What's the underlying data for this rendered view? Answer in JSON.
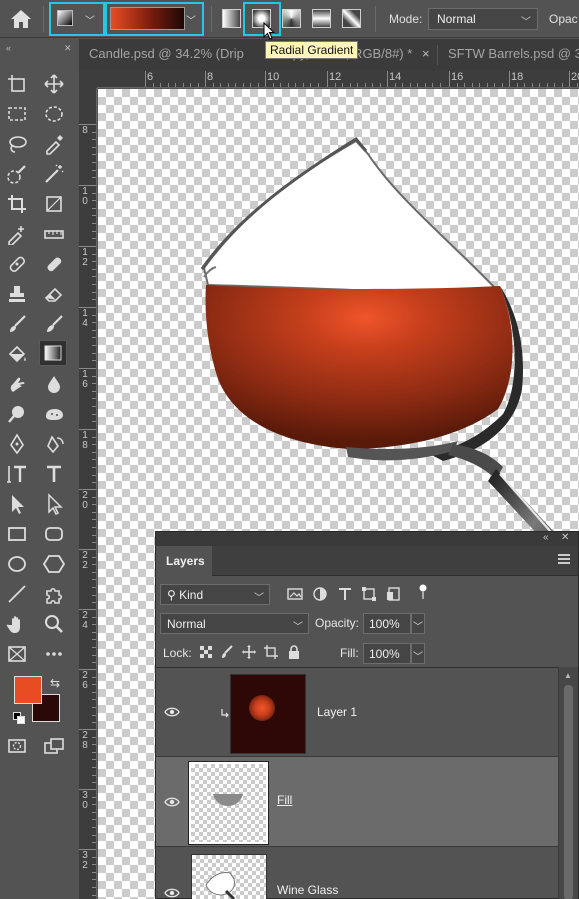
{
  "options_bar": {
    "home_icon": "home-icon",
    "mode_label": "Mode:",
    "mode_value": "Normal",
    "opacity_label": "Opac",
    "gradient_colors": [
      "#e84c22",
      "#7a1c0e",
      "#1c0907"
    ],
    "highlight_color": "#22c8e6"
  },
  "tooltip": {
    "text": "Radial Gradient"
  },
  "tabs": [
    {
      "label": "Candle.psd @ 34.2% (Drip ",
      "close": ""
    },
    {
      "label": "Copy, Glass, RGB/8#) *",
      "close": "×"
    },
    {
      "label": "SFTW Barrels.psd @ 3",
      "close": ""
    }
  ],
  "ruler_top": {
    "labels": [
      "6",
      "8",
      "10",
      "12",
      "14",
      "16",
      "18",
      "20"
    ]
  },
  "ruler_left": {
    "labels": [
      "8",
      "1\n0",
      "1\n2",
      "1\n4",
      "1\n6",
      "1\n8",
      "2\n0",
      "2\n2",
      "2\n4",
      "2\n6",
      "2\n8",
      "3\n0",
      "3\n2"
    ]
  },
  "toolbar": {
    "foreground_color": "#e84c22",
    "background_color": "#2a0a08"
  },
  "layers_panel": {
    "tab_label": "Layers",
    "filter_kind": "Kind",
    "blend_mode": "Normal",
    "opacity_label": "Opacity:",
    "opacity_value": "100%",
    "lock_label": "Lock:",
    "fill_label": "Fill:",
    "fill_value": "100%",
    "layers": [
      {
        "name": "Layer 1",
        "selected": false,
        "clipped": true
      },
      {
        "name": "Fill",
        "selected": true,
        "clipped": false
      },
      {
        "name": "Wine Glass",
        "selected": false,
        "clipped": false
      }
    ]
  }
}
